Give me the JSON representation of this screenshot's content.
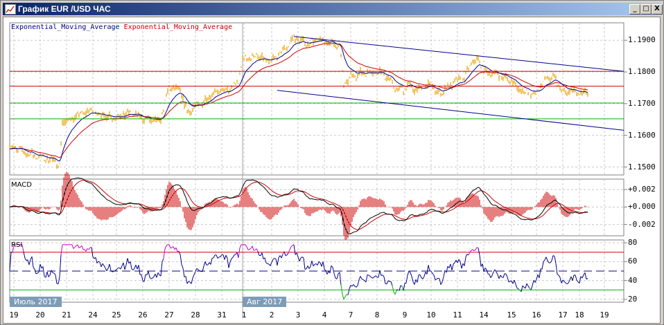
{
  "window": {
    "title": "График EUR /USD  ЧАС",
    "buttons": {
      "minimize": "_",
      "maximize": "□",
      "close": "X"
    }
  },
  "legend": {
    "ema_fast": "Exponential_Moving_Average",
    "ema_slow": "Exponential_Moving_Average",
    "ema_fast_color": "#00008b",
    "ema_slow_color": "#cc0000"
  },
  "panels": {
    "macd_title": "MACD",
    "rsi_title": "RSI"
  },
  "months": [
    {
      "label": "Июль 2017",
      "bar": 0
    },
    {
      "label": "Авг 2017",
      "bar": 168
    }
  ],
  "chart_data": [
    {
      "type": "line",
      "title": "EUR/USD H1",
      "ylim": [
        1.1475,
        1.1955
      ],
      "yticks": [
        {
          "v": 1.19,
          "label": "1.1900"
        },
        {
          "v": 1.18,
          "label": "1.1800"
        },
        {
          "v": 1.17,
          "label": "1.1700"
        },
        {
          "v": 1.16,
          "label": "1.1600"
        },
        {
          "v": 1.15,
          "label": "1.1500"
        }
      ],
      "xlim": [
        0,
        443
      ],
      "xticks": [
        {
          "bar": 3,
          "label": "19"
        },
        {
          "bar": 22,
          "label": "20"
        },
        {
          "bar": 41,
          "label": "21"
        },
        {
          "bar": 60,
          "label": "24"
        },
        {
          "bar": 77,
          "label": "25"
        },
        {
          "bar": 96,
          "label": "26"
        },
        {
          "bar": 115,
          "label": "27"
        },
        {
          "bar": 134,
          "label": "28"
        },
        {
          "bar": 153,
          "label": "31"
        },
        {
          "bar": 169,
          "label": "1"
        },
        {
          "bar": 189,
          "label": "2"
        },
        {
          "bar": 208,
          "label": "3"
        },
        {
          "bar": 227,
          "label": "4"
        },
        {
          "bar": 246,
          "label": "7"
        },
        {
          "bar": 265,
          "label": "8"
        },
        {
          "bar": 285,
          "label": "9"
        },
        {
          "bar": 304,
          "label": "10"
        },
        {
          "bar": 323,
          "label": "11"
        },
        {
          "bar": 342,
          "label": "14"
        },
        {
          "bar": 362,
          "label": "15"
        },
        {
          "bar": 380,
          "label": "16"
        },
        {
          "bar": 399,
          "label": "17"
        },
        {
          "bar": 411,
          "label": "18"
        },
        {
          "bar": 429,
          "label": "19"
        }
      ],
      "price_keypoints": [
        [
          0,
          1.1565
        ],
        [
          18,
          1.1535
        ],
        [
          33,
          1.152
        ],
        [
          36,
          1.1505
        ],
        [
          38,
          1.164
        ],
        [
          48,
          1.166
        ],
        [
          58,
          1.168
        ],
        [
          68,
          1.166
        ],
        [
          78,
          1.166
        ],
        [
          88,
          1.167
        ],
        [
          98,
          1.165
        ],
        [
          108,
          1.164
        ],
        [
          115,
          1.175
        ],
        [
          123,
          1.174
        ],
        [
          128,
          1.167
        ],
        [
          138,
          1.17
        ],
        [
          148,
          1.174
        ],
        [
          158,
          1.174
        ],
        [
          165,
          1.177
        ],
        [
          168,
          1.184
        ],
        [
          178,
          1.185
        ],
        [
          188,
          1.183
        ],
        [
          198,
          1.187
        ],
        [
          205,
          1.191
        ],
        [
          213,
          1.189
        ],
        [
          223,
          1.19
        ],
        [
          233,
          1.189
        ],
        [
          238,
          1.188
        ],
        [
          241,
          1.176
        ],
        [
          248,
          1.179
        ],
        [
          258,
          1.18
        ],
        [
          268,
          1.18
        ],
        [
          275,
          1.177
        ],
        [
          280,
          1.174
        ],
        [
          288,
          1.176
        ],
        [
          295,
          1.174
        ],
        [
          303,
          1.176
        ],
        [
          310,
          1.173
        ],
        [
          318,
          1.176
        ],
        [
          328,
          1.178
        ],
        [
          333,
          1.183
        ],
        [
          338,
          1.184
        ],
        [
          343,
          1.18
        ],
        [
          353,
          1.179
        ],
        [
          363,
          1.177
        ],
        [
          368,
          1.174
        ],
        [
          378,
          1.173
        ],
        [
          388,
          1.178
        ],
        [
          393,
          1.178
        ],
        [
          400,
          1.173
        ],
        [
          405,
          1.174
        ],
        [
          413,
          1.173
        ],
        [
          417,
          1.1735
        ]
      ],
      "series": [
        {
          "name": "Price",
          "color": "#e8a000"
        },
        {
          "name": "Exponential_Moving_Average (fast)",
          "period": 12,
          "color": "#00008b"
        },
        {
          "name": "Exponential_Moving_Average (slow)",
          "period": 30,
          "color": "#cc0000"
        }
      ],
      "horizontal_levels": [
        {
          "v": 1.1802,
          "color": "#cc0000"
        },
        {
          "v": 1.1755,
          "color": "#cc0000"
        },
        {
          "v": 1.1702,
          "color": "#00b000"
        },
        {
          "v": 1.1652,
          "color": "#00b000"
        }
      ],
      "trend_lines": [
        {
          "from": [
            205,
            1.1912
          ],
          "to": [
            443,
            1.1802
          ],
          "color": "#00008b"
        },
        {
          "from": [
            193,
            1.1742
          ],
          "to": [
            443,
            1.1616
          ],
          "color": "#00008b"
        }
      ]
    },
    {
      "type": "bar",
      "title": "MACD",
      "ylim": [
        -0.0033,
        0.0032
      ],
      "yticks": [
        {
          "v": 0.002,
          "label": "+0.002"
        },
        {
          "v": 0,
          "label": "+0.000"
        },
        {
          "v": -0.002,
          "label": "-0.002"
        }
      ],
      "series": [
        {
          "name": "MACD",
          "color": "#000000"
        },
        {
          "name": "Signal",
          "color": "#cc0000"
        },
        {
          "name": "Histogram",
          "color": "#cc0000"
        }
      ]
    },
    {
      "type": "line",
      "title": "RSI",
      "ylim": [
        20,
        80
      ],
      "yticks": [
        {
          "v": 80,
          "label": "80"
        },
        {
          "v": 60,
          "label": "60"
        },
        {
          "v": 40,
          "label": "40"
        },
        {
          "v": 20,
          "label": "20"
        }
      ],
      "levels": [
        {
          "v": 70,
          "color": "#cc0000"
        },
        {
          "v": 50,
          "color": "#00008b"
        },
        {
          "v": 30,
          "color": "#00b000"
        }
      ],
      "series": [
        {
          "name": "RSI",
          "period": 14,
          "color": "#00008b",
          "overbought_color": "#cc00cc",
          "oversold_color": "#00b000"
        }
      ]
    }
  ]
}
